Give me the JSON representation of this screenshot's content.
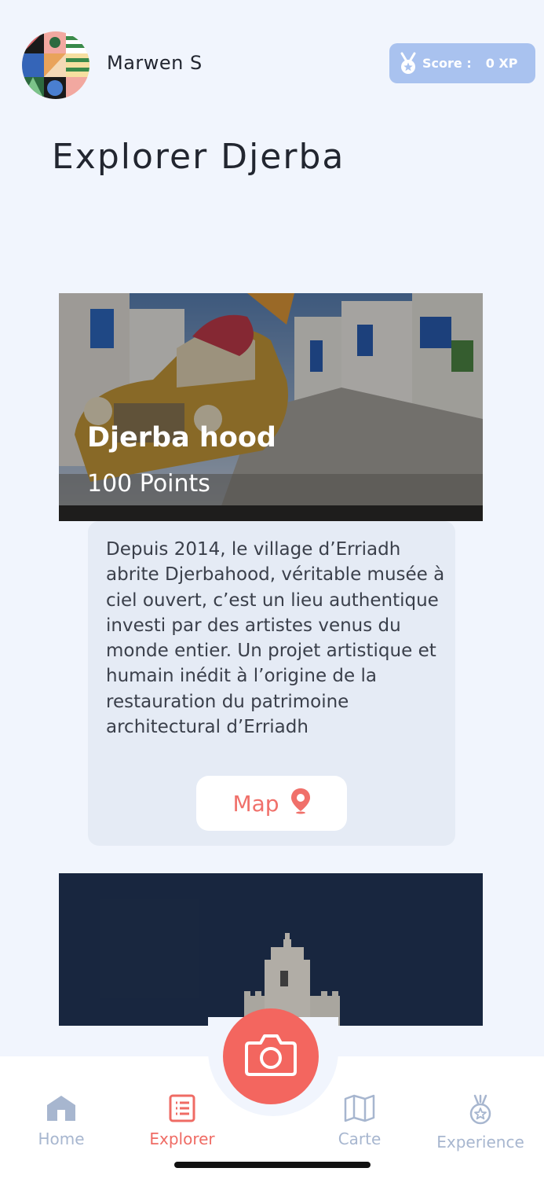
{
  "user": {
    "name": "Marwen S"
  },
  "score": {
    "label": "Score :",
    "value": "0 XP"
  },
  "page": {
    "title": "Explorer Djerba"
  },
  "cards": [
    {
      "title": "Djerba hood",
      "points": "100 Points",
      "description": "Depuis 2014, le village d’Erriadh abrite Djerbahood, véritable musée à ciel ouvert, c’est un lieu authentique investi par des artistes venus du monde entier. Un projet artistique et humain inédit à l’origine de la restauration du patrimoine architectural d’Erriadh",
      "map_label": "Map"
    }
  ],
  "nav": {
    "items": [
      {
        "label": "Home",
        "icon": "home-icon"
      },
      {
        "label": "Explorer",
        "icon": "list-icon",
        "active": true
      },
      {
        "label": "Carte",
        "icon": "map-icon"
      },
      {
        "label": "Experience",
        "icon": "medal-icon"
      }
    ],
    "fab_icon": "camera-icon"
  },
  "colors": {
    "background": "#f1f5fd",
    "accent": "#f3665f",
    "score_badge": "#a9c2ef",
    "inactive_nav": "#a7b6cf"
  }
}
